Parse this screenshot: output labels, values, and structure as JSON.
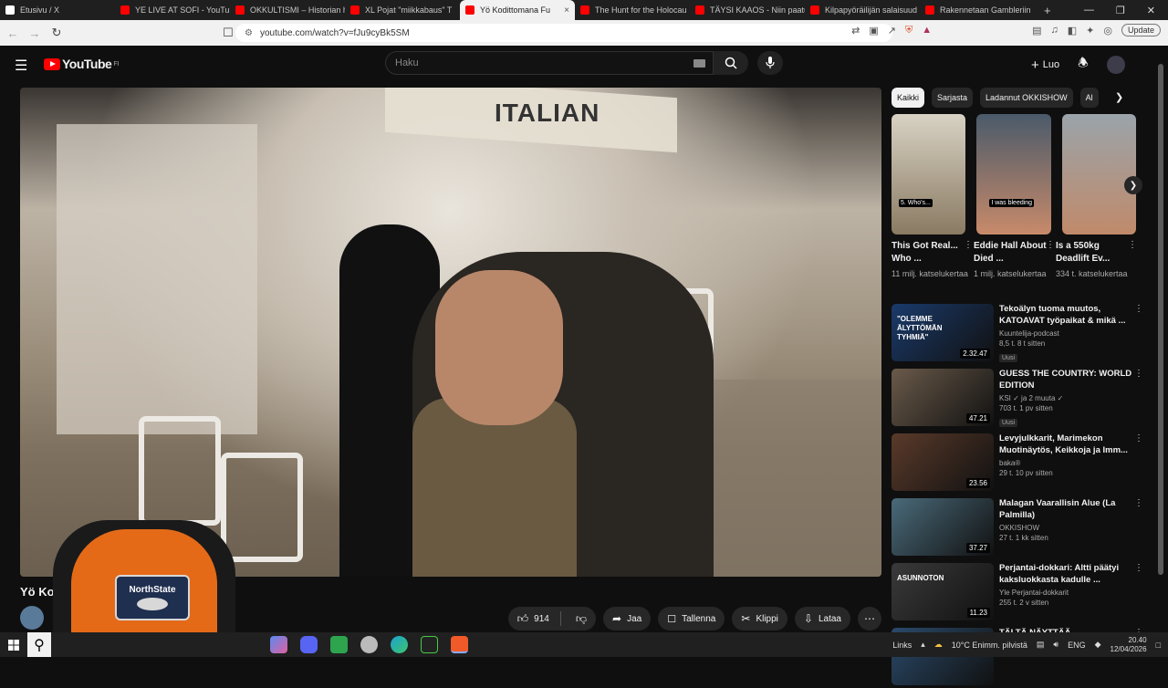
{
  "browser": {
    "tabs": [
      {
        "label": "Etusivu / X",
        "fav": "#ffffff"
      },
      {
        "label": "YE LIVE AT SOFI - YouTube",
        "fav": "#ff0000"
      },
      {
        "label": "OKKULTISMI – Historian hu",
        "fav": "#ff0000"
      },
      {
        "label": "XL Pojat \"miikkabaus\" T",
        "fav": "#ff0000"
      },
      {
        "label": "Yö Kodittomana Fu",
        "fav": "#ff0000",
        "active": true
      },
      {
        "label": "The Hunt for the Holocau",
        "fav": "#ff0000"
      },
      {
        "label": "TÄYSI KAAOS - Niin paatu",
        "fav": "#ff0000"
      },
      {
        "label": "Kilpapyöräilijän salaisuud",
        "fav": "#ff0000"
      },
      {
        "label": "Rakennetaan Gambleriin",
        "fav": "#ff0000"
      }
    ],
    "url": "youtube.com/watch?v=fJu9cyBk5SM",
    "update_label": "Update"
  },
  "youtube": {
    "logo": "YouTube",
    "country": "FI",
    "search_placeholder": "Haku",
    "create_label": "Luo"
  },
  "video": {
    "title_partial": "Yö Ko",
    "overlay_sign": "ITALIAN",
    "cap_text": "NorthState",
    "actions": {
      "likes": "914",
      "share": "Jaa",
      "save": "Tallenna",
      "clip": "Klippi",
      "download": "Lataa"
    }
  },
  "chips": [
    "Kaikki",
    "Sarjasta",
    "Ladannut OKKISHOW",
    "Al"
  ],
  "shorts": [
    {
      "title": "This Got Real... Who ...",
      "views": "11 milj. katselukertaa",
      "caption": "5. Who's..."
    },
    {
      "title": "Eddie Hall About Died ...",
      "views": "1 milj. katselukertaa",
      "caption": "I was bleeding"
    },
    {
      "title": "Is a 550kg Deadlift Ev...",
      "views": "334 t. katselukertaa",
      "caption": ""
    }
  ],
  "recommendations": [
    {
      "title": "Tekoälyn tuoma muutos, KATOAVAT työpaikat & mikä ...",
      "channel": "Kuuntelija-podcast",
      "stats": "8,5 t.  8 t sitten",
      "badge": "Uusi",
      "duration": "2.32.47",
      "thumb_text": "\"OLEMME ÄLYTTÖMÄN TYHMIÄ\"",
      "color": "#1a3a6a"
    },
    {
      "title": "GUESS THE COUNTRY: WORLD EDITION",
      "channel": "KSI ✓ ja 2 muuta ✓",
      "stats": "703 t.  1 pv sitten",
      "badge": "Uusi",
      "duration": "47.21",
      "thumb_text": "",
      "color": "#6a5a4a"
    },
    {
      "title": "Levyjulkkarit, Marimekon Muotinäytös, Keikkoja ja Imm...",
      "channel": "baka®",
      "stats": "29 t.  10 pv sitten",
      "badge": "",
      "duration": "23.56",
      "thumb_text": "",
      "color": "#5a3a2a"
    },
    {
      "title": "Malagan Vaarallisin Alue (La Palmilla)",
      "channel": "OKKISHOW",
      "stats": "27 t.  1 kk sitten",
      "badge": "",
      "duration": "37.27",
      "thumb_text": "",
      "color": "#4a6a7a"
    },
    {
      "title": "Perjantai-dokkari: Altti päätyi kaksluokkasta kadulle ...",
      "channel": "Yle Perjantai-dokkarit",
      "stats": "255 t.  2 v sitten",
      "badge": "",
      "duration": "11.23",
      "thumb_text": "ASUNNOTON",
      "color": "#3a3a3a"
    },
    {
      "title": "TÄLTÄ NÄYTTÄÄ",
      "channel": "",
      "stats": "",
      "badge": "",
      "duration": "",
      "thumb_text": "",
      "color": "#2a4a6a"
    }
  ],
  "taskbar": {
    "links": "Links",
    "weather": "10°C  Enimm. pilvistä",
    "lang": "ENG",
    "time": "20.40",
    "date": "12/04/2026"
  }
}
